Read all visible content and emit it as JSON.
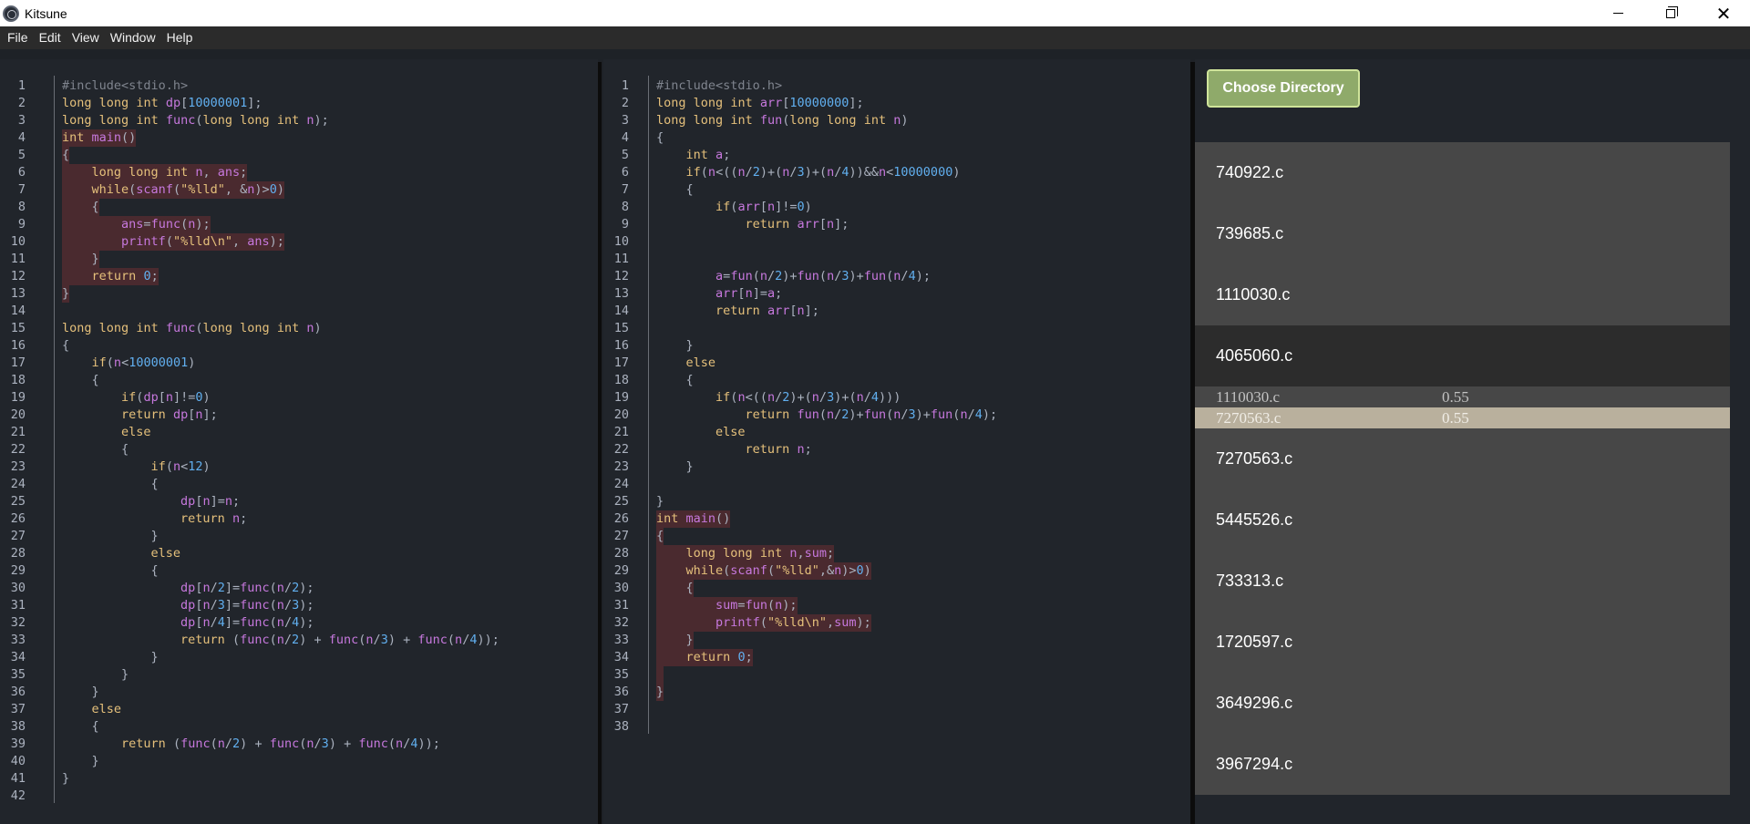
{
  "window": {
    "title": "Kitsune",
    "minimize_icon": "minimize-icon",
    "maximize_icon": "restore-icon",
    "close_icon": "close-icon",
    "close_glyph": "✕"
  },
  "menu": [
    "File",
    "Edit",
    "View",
    "Window",
    "Help"
  ],
  "left_editor": {
    "lines": [
      {
        "n": "1",
        "text": "#include<stdio.h>",
        "hl": false
      },
      {
        "n": "2",
        "text": "long long int dp[10000001];",
        "hl": false
      },
      {
        "n": "3",
        "text": "long long int func(long long int n);",
        "hl": false
      },
      {
        "n": "4",
        "text": "int main()",
        "hl": true
      },
      {
        "n": "5",
        "text": "{",
        "hl": true
      },
      {
        "n": "6",
        "text": "    long long int n, ans;",
        "hl": true
      },
      {
        "n": "7",
        "text": "    while(scanf(\"%lld\", &n)>0)",
        "hl": true
      },
      {
        "n": "8",
        "text": "    {",
        "hl": true
      },
      {
        "n": "9",
        "text": "        ans=func(n);",
        "hl": true
      },
      {
        "n": "10",
        "text": "        printf(\"%lld\\n\", ans);",
        "hl": true
      },
      {
        "n": "11",
        "text": "    }",
        "hl": true
      },
      {
        "n": "12",
        "text": "    return 0;",
        "hl": true
      },
      {
        "n": "13",
        "text": "}",
        "hl": true
      },
      {
        "n": "14",
        "text": "",
        "hl": false
      },
      {
        "n": "15",
        "text": "long long int func(long long int n)",
        "hl": false
      },
      {
        "n": "16",
        "text": "{",
        "hl": false
      },
      {
        "n": "17",
        "text": "    if(n<10000001)",
        "hl": false
      },
      {
        "n": "18",
        "text": "    {",
        "hl": false
      },
      {
        "n": "19",
        "text": "        if(dp[n]!=0)",
        "hl": false
      },
      {
        "n": "20",
        "text": "        return dp[n];",
        "hl": false
      },
      {
        "n": "21",
        "text": "        else",
        "hl": false
      },
      {
        "n": "22",
        "text": "        {",
        "hl": false
      },
      {
        "n": "23",
        "text": "            if(n<12)",
        "hl": false
      },
      {
        "n": "24",
        "text": "            {",
        "hl": false
      },
      {
        "n": "25",
        "text": "                dp[n]=n;",
        "hl": false
      },
      {
        "n": "26",
        "text": "                return n;",
        "hl": false
      },
      {
        "n": "27",
        "text": "            }",
        "hl": false
      },
      {
        "n": "28",
        "text": "            else",
        "hl": false
      },
      {
        "n": "29",
        "text": "            {",
        "hl": false
      },
      {
        "n": "30",
        "text": "                dp[n/2]=func(n/2);",
        "hl": false
      },
      {
        "n": "31",
        "text": "                dp[n/3]=func(n/3);",
        "hl": false
      },
      {
        "n": "32",
        "text": "                dp[n/4]=func(n/4);",
        "hl": false
      },
      {
        "n": "33",
        "text": "                return (func(n/2) + func(n/3) + func(n/4));",
        "hl": false
      },
      {
        "n": "34",
        "text": "            }",
        "hl": false
      },
      {
        "n": "35",
        "text": "        }",
        "hl": false
      },
      {
        "n": "36",
        "text": "    }",
        "hl": false
      },
      {
        "n": "37",
        "text": "    else",
        "hl": false
      },
      {
        "n": "38",
        "text": "    {",
        "hl": false
      },
      {
        "n": "39",
        "text": "        return (func(n/2) + func(n/3) + func(n/4));",
        "hl": false
      },
      {
        "n": "40",
        "text": "    }",
        "hl": false
      },
      {
        "n": "41",
        "text": "}",
        "hl": false
      },
      {
        "n": "42",
        "text": "",
        "hl": false
      }
    ]
  },
  "right_editor": {
    "lines": [
      {
        "n": "1",
        "text": "#include<stdio.h>",
        "hl": false
      },
      {
        "n": "2",
        "text": "long long int arr[10000000];",
        "hl": false
      },
      {
        "n": "3",
        "text": "long long int fun(long long int n)",
        "hl": false
      },
      {
        "n": "4",
        "text": "{",
        "hl": false
      },
      {
        "n": "5",
        "text": "    int a;",
        "hl": false
      },
      {
        "n": "6",
        "text": "    if(n<((n/2)+(n/3)+(n/4))&&n<10000000)",
        "hl": false
      },
      {
        "n": "7",
        "text": "    {",
        "hl": false
      },
      {
        "n": "8",
        "text": "        if(arr[n]!=0)",
        "hl": false
      },
      {
        "n": "9",
        "text": "            return arr[n];",
        "hl": false
      },
      {
        "n": "10",
        "text": "",
        "hl": false
      },
      {
        "n": "11",
        "text": "",
        "hl": false
      },
      {
        "n": "12",
        "text": "        a=fun(n/2)+fun(n/3)+fun(n/4);",
        "hl": false
      },
      {
        "n": "13",
        "text": "        arr[n]=a;",
        "hl": false
      },
      {
        "n": "14",
        "text": "        return arr[n];",
        "hl": false
      },
      {
        "n": "15",
        "text": "",
        "hl": false
      },
      {
        "n": "16",
        "text": "    }",
        "hl": false
      },
      {
        "n": "17",
        "text": "    else",
        "hl": false
      },
      {
        "n": "18",
        "text": "    {",
        "hl": false
      },
      {
        "n": "19",
        "text": "        if(n<((n/2)+(n/3)+(n/4)))",
        "hl": false
      },
      {
        "n": "20",
        "text": "            return fun(n/2)+fun(n/3)+fun(n/4);",
        "hl": false
      },
      {
        "n": "21",
        "text": "        else",
        "hl": false
      },
      {
        "n": "22",
        "text": "            return n;",
        "hl": false
      },
      {
        "n": "23",
        "text": "    }",
        "hl": false
      },
      {
        "n": "24",
        "text": "",
        "hl": false
      },
      {
        "n": "25",
        "text": "}",
        "hl": false
      },
      {
        "n": "26",
        "text": "int main()",
        "hl": true
      },
      {
        "n": "27",
        "text": "{",
        "hl": true
      },
      {
        "n": "28",
        "text": "    long long int n,sum;",
        "hl": true
      },
      {
        "n": "29",
        "text": "    while(scanf(\"%lld\",&n)>0)",
        "hl": true
      },
      {
        "n": "30",
        "text": "    {",
        "hl": true
      },
      {
        "n": "31",
        "text": "        sum=fun(n);",
        "hl": true
      },
      {
        "n": "32",
        "text": "        printf(\"%lld\\n\",sum);",
        "hl": true
      },
      {
        "n": "33",
        "text": "    }",
        "hl": true
      },
      {
        "n": "34",
        "text": "    return 0;",
        "hl": true
      },
      {
        "n": "35",
        "text": "",
        "hl": true
      },
      {
        "n": "36",
        "text": "}",
        "hl": true
      },
      {
        "n": "37",
        "text": "",
        "hl": false
      },
      {
        "n": "38",
        "text": "",
        "hl": false
      }
    ]
  },
  "panel": {
    "choose_label": "Choose Directory",
    "files_top": [
      "740922.c",
      "739685.c",
      "1110030.c"
    ],
    "selected_file": "4065060.c",
    "matches": [
      {
        "name": "1110030.c",
        "score": "0.55",
        "selected": false
      },
      {
        "name": "7270563.c",
        "score": "0.55",
        "selected": true
      }
    ],
    "files_bottom": [
      "7270563.c",
      "5445526.c",
      "733313.c",
      "1720597.c",
      "3649296.c",
      "3967294.c"
    ]
  },
  "colors": {
    "keyword": "#e5c07b",
    "function": "#c678dd",
    "number": "#61afef",
    "highlight": "#4a2a2f",
    "button": "#8faa6a"
  }
}
